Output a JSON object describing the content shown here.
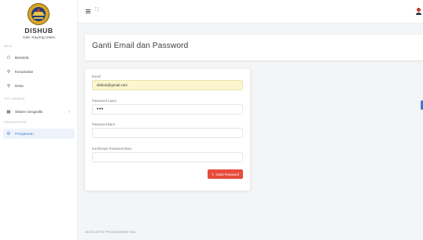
{
  "sidebar": {
    "brand": "DISHUB",
    "subtitle": "Kab. Kayong Utara",
    "section_main": "MAIN",
    "section_lainnya": "SIG LAINNYA",
    "section_pengaturan": "PENGATURAN",
    "items": [
      {
        "label": "Beranda",
        "icon": "home-icon"
      },
      {
        "label": "Kecamatan",
        "icon": "pin-icon"
      },
      {
        "label": "Desa",
        "icon": "pin-icon"
      },
      {
        "label": "Sistem Geografis",
        "icon": "map-icon"
      },
      {
        "label": "Pengaturan",
        "icon": "gear-icon"
      }
    ]
  },
  "header": {
    "title": "Ganti Email dan Password"
  },
  "form": {
    "email_label": "Email",
    "email_value": "dishub@gmail.com",
    "old_password_label": "Password Lama",
    "old_password_value": "•••",
    "new_password_label": "Password Baru",
    "confirm_password_label": "Konfirmasi Password Baru",
    "submit_label": "Ganti Password"
  },
  "footer": {
    "text": "DEVELOPED PROGRAMMER KKU"
  },
  "colors": {
    "accent": "#3b7ddd",
    "danger": "#e74c3c",
    "autofill": "#fbf6cf"
  }
}
